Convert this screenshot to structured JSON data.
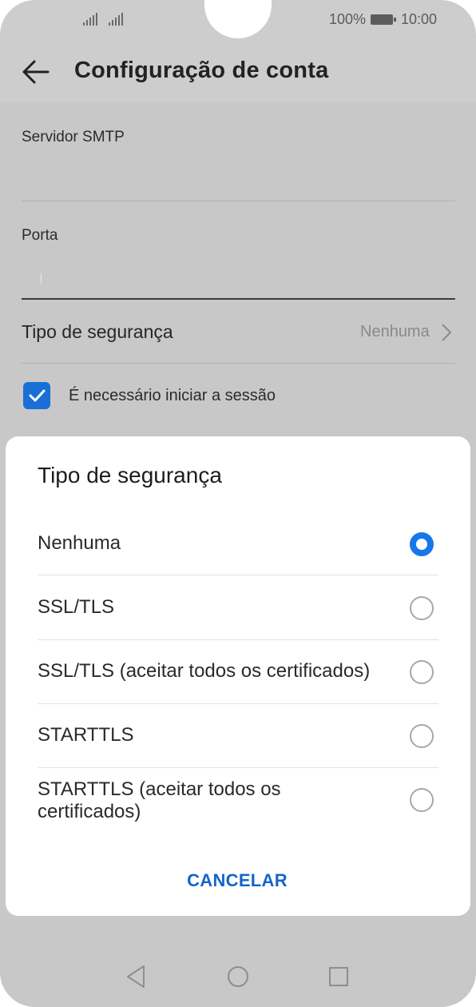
{
  "status_bar": {
    "battery_percent": "100%",
    "time": "10:00",
    "icons": [
      "signal-icon",
      "signal-icon",
      "battery-icon"
    ]
  },
  "header": {
    "back_icon": "arrow-left-icon",
    "title": "Configuração de conta"
  },
  "form": {
    "smtp_label": "Servidor SMTP",
    "smtp_value": "",
    "port_label": "Porta",
    "port_value": "",
    "security_label": "Tipo de segurança",
    "security_value": "Nenhuma",
    "login_required_label": "É necessário iniciar a sessão",
    "login_required_checked": true
  },
  "dialog": {
    "title": "Tipo de segurança",
    "options": [
      {
        "label": "Nenhuma",
        "selected": true
      },
      {
        "label": "SSL/TLS",
        "selected": false
      },
      {
        "label": "SSL/TLS (aceitar todos os certificados)",
        "selected": false
      },
      {
        "label": "STARTTLS",
        "selected": false
      },
      {
        "label": "STARTTLS (aceitar todos os certificados)",
        "selected": false
      }
    ],
    "cancel_label": "CANCELAR"
  },
  "nav_bar": {
    "icons": [
      "back-triangle-icon",
      "home-circle-icon",
      "recents-square-icon"
    ]
  },
  "colors": {
    "accent": "#1677ea",
    "checkbox": "#1a6fd6",
    "cancel_text": "#1565c9",
    "scrim": "#cdcdcd"
  }
}
